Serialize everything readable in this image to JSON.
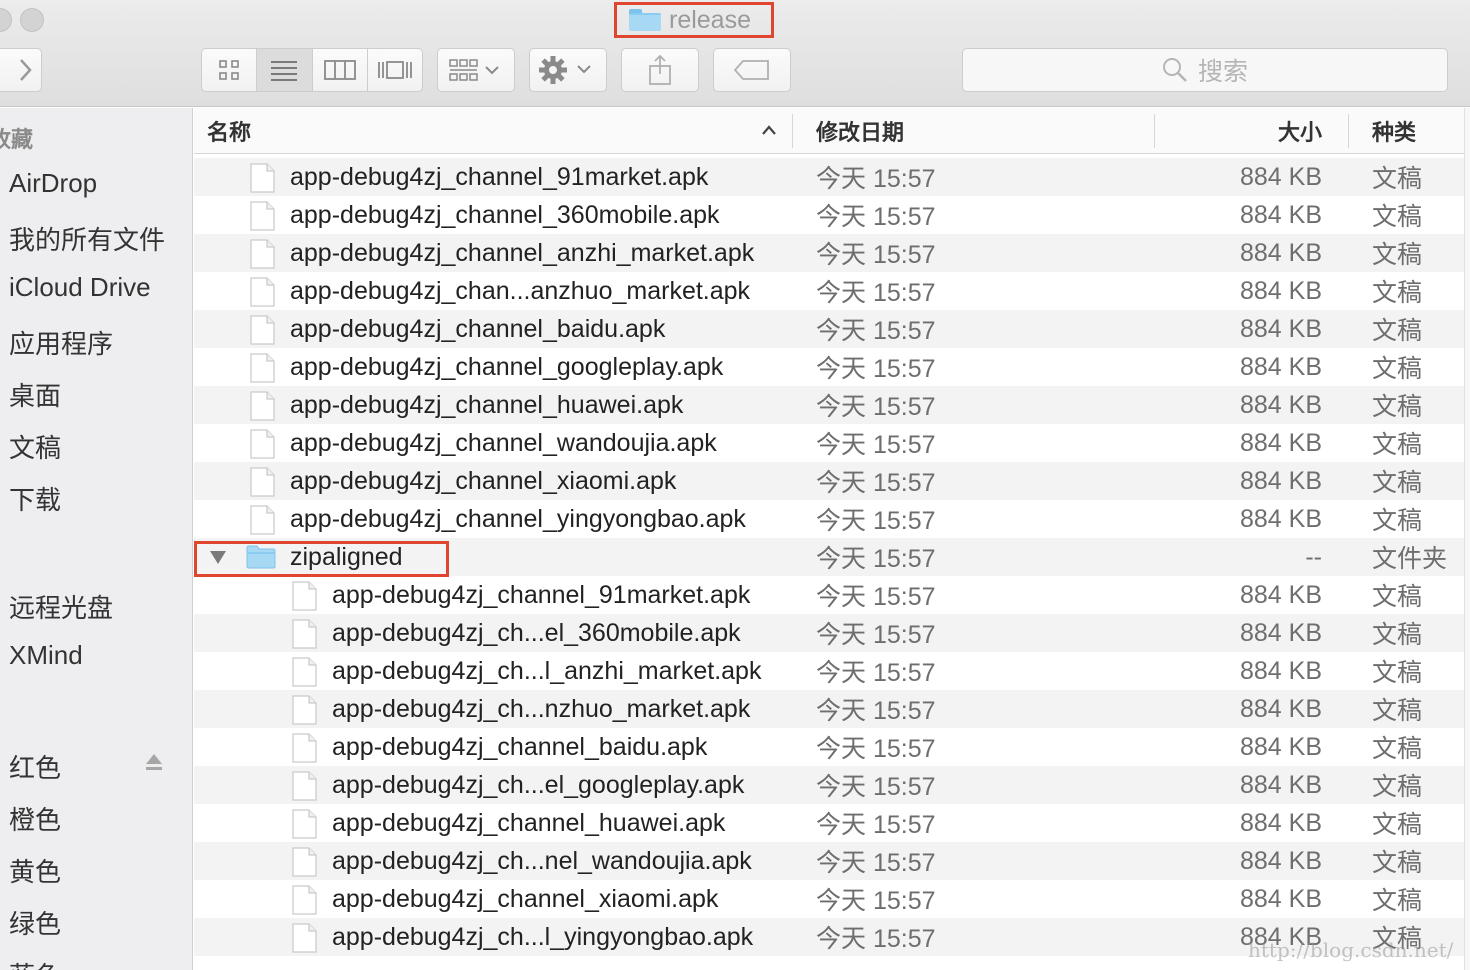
{
  "window": {
    "title": "release"
  },
  "toolbar": {
    "search_placeholder": "搜索",
    "icons": [
      "forward-chevron-icon",
      "icon-view-icon",
      "list-view-icon",
      "column-view-icon",
      "cover-flow-icon",
      "arrange-icon",
      "gear-icon",
      "share-icon",
      "tag-icon",
      "search-icon"
    ]
  },
  "sidebar": {
    "favorites_header": "收藏",
    "favorites": [
      "AirDrop",
      "我的所有文件",
      "iCloud Drive",
      "应用程序",
      "桌面",
      "文稿",
      "下载"
    ],
    "devices": [
      "远程光盘",
      "XMind"
    ],
    "tags": [
      "红色",
      "橙色",
      "黄色",
      "绿色",
      "蓝色"
    ]
  },
  "list": {
    "columns": {
      "name": "名称",
      "date": "修改日期",
      "size": "大小",
      "kind": "种类"
    },
    "rows": [
      {
        "name": "app-debug4zj_channel_91market.apk",
        "date": "今天 15:57",
        "size": "884 KB",
        "kind": "文稿"
      },
      {
        "name": "app-debug4zj_channel_360mobile.apk",
        "date": "今天 15:57",
        "size": "884 KB",
        "kind": "文稿"
      },
      {
        "name": "app-debug4zj_channel_anzhi_market.apk",
        "date": "今天 15:57",
        "size": "884 KB",
        "kind": "文稿"
      },
      {
        "name": "app-debug4zj_chan...anzhuo_market.apk",
        "date": "今天 15:57",
        "size": "884 KB",
        "kind": "文稿"
      },
      {
        "name": "app-debug4zj_channel_baidu.apk",
        "date": "今天 15:57",
        "size": "884 KB",
        "kind": "文稿"
      },
      {
        "name": "app-debug4zj_channel_googleplay.apk",
        "date": "今天 15:57",
        "size": "884 KB",
        "kind": "文稿"
      },
      {
        "name": "app-debug4zj_channel_huawei.apk",
        "date": "今天 15:57",
        "size": "884 KB",
        "kind": "文稿"
      },
      {
        "name": "app-debug4zj_channel_wandoujia.apk",
        "date": "今天 15:57",
        "size": "884 KB",
        "kind": "文稿"
      },
      {
        "name": "app-debug4zj_channel_xiaomi.apk",
        "date": "今天 15:57",
        "size": "884 KB",
        "kind": "文稿"
      },
      {
        "name": "app-debug4zj_channel_yingyongbao.apk",
        "date": "今天 15:57",
        "size": "884 KB",
        "kind": "文稿"
      },
      {
        "name": "zipaligned",
        "date": "今天 15:57",
        "size": "--",
        "kind": "文件夹"
      },
      {
        "name": "app-debug4zj_channel_91market.apk",
        "date": "今天 15:57",
        "size": "884 KB",
        "kind": "文稿"
      },
      {
        "name": "app-debug4zj_ch...el_360mobile.apk",
        "date": "今天 15:57",
        "size": "884 KB",
        "kind": "文稿"
      },
      {
        "name": "app-debug4zj_ch...l_anzhi_market.apk",
        "date": "今天 15:57",
        "size": "884 KB",
        "kind": "文稿"
      },
      {
        "name": "app-debug4zj_ch...nzhuo_market.apk",
        "date": "今天 15:57",
        "size": "884 KB",
        "kind": "文稿"
      },
      {
        "name": "app-debug4zj_channel_baidu.apk",
        "date": "今天 15:57",
        "size": "884 KB",
        "kind": "文稿"
      },
      {
        "name": "app-debug4zj_ch...el_googleplay.apk",
        "date": "今天 15:57",
        "size": "884 KB",
        "kind": "文稿"
      },
      {
        "name": "app-debug4zj_channel_huawei.apk",
        "date": "今天 15:57",
        "size": "884 KB",
        "kind": "文稿"
      },
      {
        "name": "app-debug4zj_ch...nel_wandoujia.apk",
        "date": "今天 15:57",
        "size": "884 KB",
        "kind": "文稿"
      },
      {
        "name": "app-debug4zj_channel_xiaomi.apk",
        "date": "今天 15:57",
        "size": "884 KB",
        "kind": "文稿"
      },
      {
        "name": "app-debug4zj_ch...l_yingyongbao.apk",
        "date": "今天 15:57",
        "size": "884 KB",
        "kind": "文稿"
      }
    ]
  },
  "watermark": "http://blog.csdn.net/",
  "colors": {
    "highlight_border": "#e0452f",
    "folder_blue": "#a7d9f5",
    "sidebar_bg": "#eeeef0",
    "row_alt": "#f3f3f4"
  }
}
